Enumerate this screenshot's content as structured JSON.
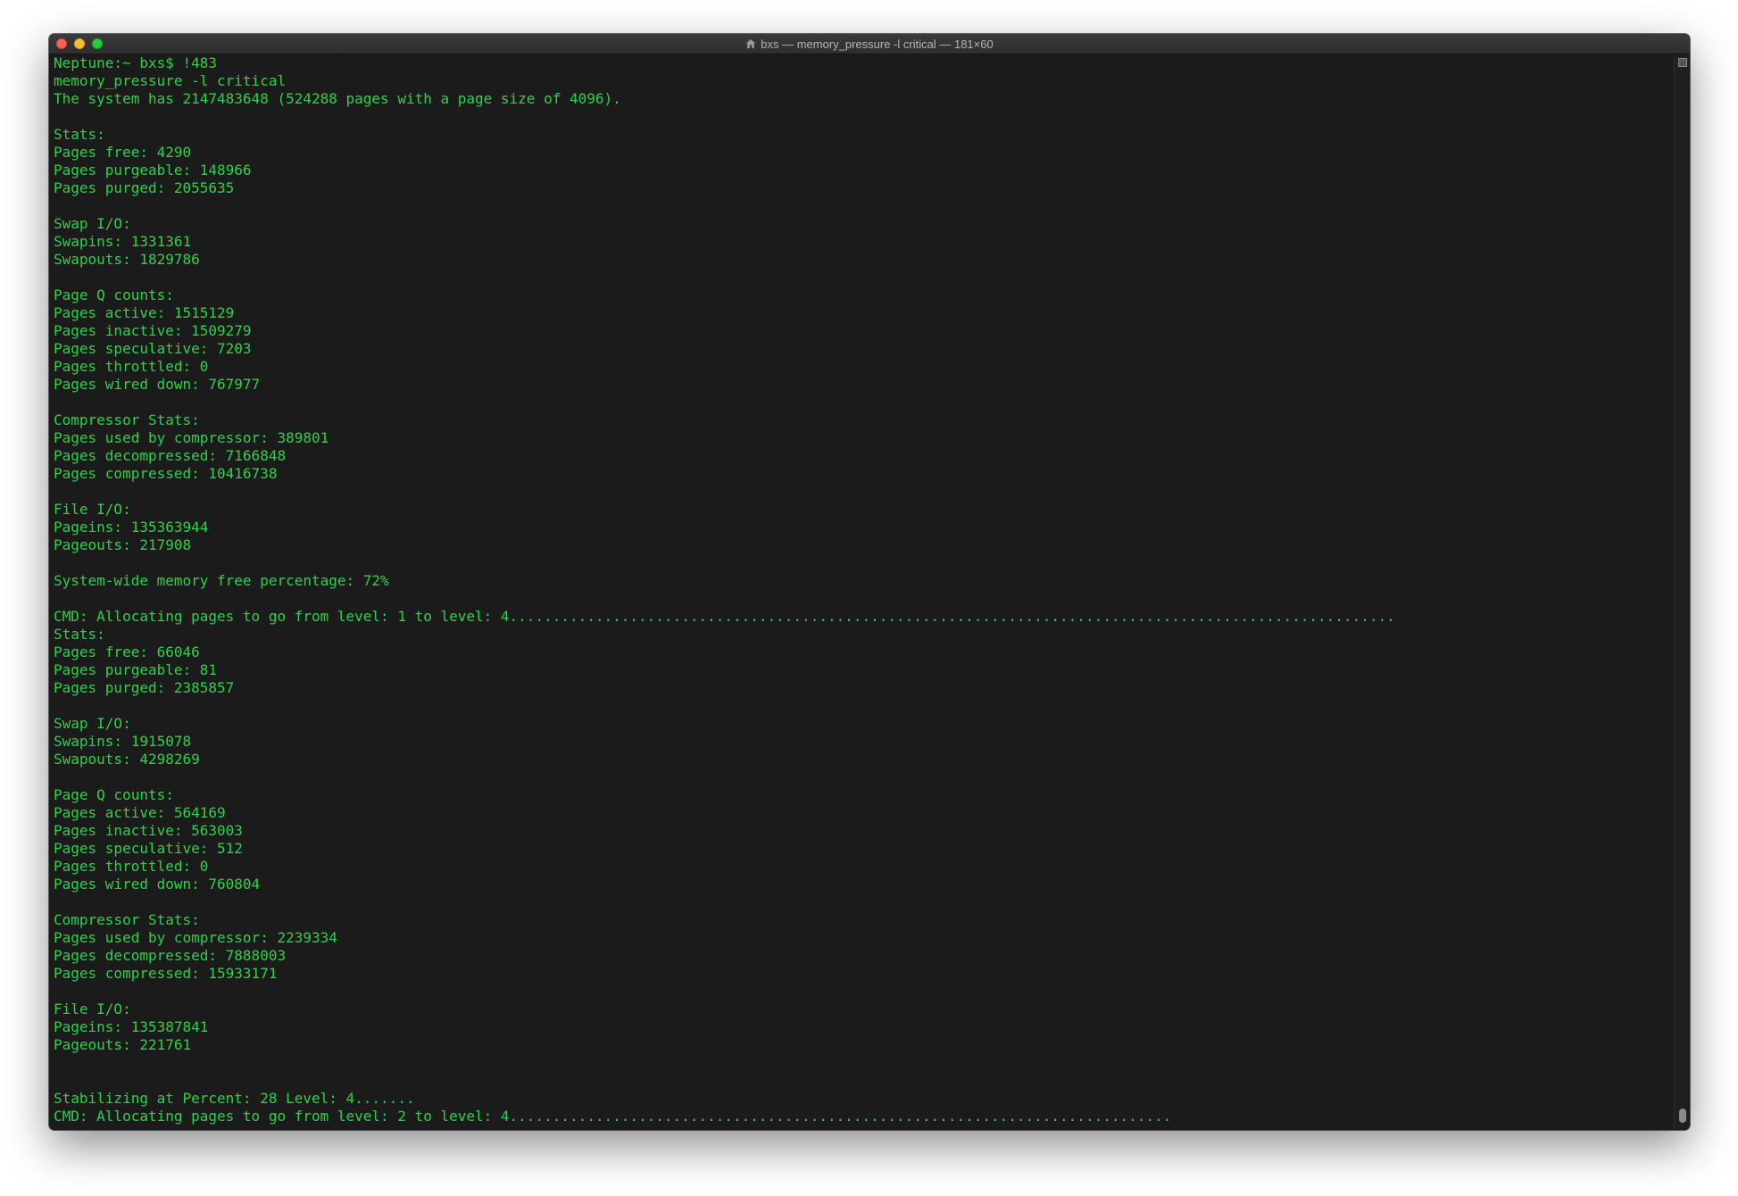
{
  "window": {
    "title": "bxs — memory_pressure -l critical — 181×60"
  },
  "terminal": {
    "lines": [
      "Neptune:~ bxs$ !483",
      "memory_pressure -l critical",
      "The system has 2147483648 (524288 pages with a page size of 4096).",
      "",
      "Stats:",
      "Pages free: 4290",
      "Pages purgeable: 148966",
      "Pages purged: 2055635",
      "",
      "Swap I/O:",
      "Swapins: 1331361",
      "Swapouts: 1829786",
      "",
      "Page Q counts:",
      "Pages active: 1515129",
      "Pages inactive: 1509279",
      "Pages speculative: 7203",
      "Pages throttled: 0",
      "Pages wired down: 767977",
      "",
      "Compressor Stats:",
      "Pages used by compressor: 389801",
      "Pages decompressed: 7166848",
      "Pages compressed: 10416738",
      "",
      "File I/O:",
      "Pageins: 135363944",
      "Pageouts: 217908",
      "",
      "System-wide memory free percentage: 72%",
      "",
      "CMD: Allocating pages to go from level: 1 to level: 4.......................................................................................................",
      "Stats:",
      "Pages free: 66046",
      "Pages purgeable: 81",
      "Pages purged: 2385857",
      "",
      "Swap I/O:",
      "Swapins: 1915078",
      "Swapouts: 4298269",
      "",
      "Page Q counts:",
      "Pages active: 564169",
      "Pages inactive: 563003",
      "Pages speculative: 512",
      "Pages throttled: 0",
      "Pages wired down: 760804",
      "",
      "Compressor Stats:",
      "Pages used by compressor: 2239334",
      "Pages decompressed: 7888003",
      "Pages compressed: 15933171",
      "",
      "File I/O:",
      "Pageins: 135387841",
      "Pageouts: 221761",
      "",
      "",
      "Stabilizing at Percent: 28 Level: 4.......",
      "CMD: Allocating pages to go from level: 2 to level: 4............................................................................."
    ]
  },
  "colors": {
    "terminal_bg": "#1b1b1b",
    "terminal_text": "#2fd14a"
  }
}
